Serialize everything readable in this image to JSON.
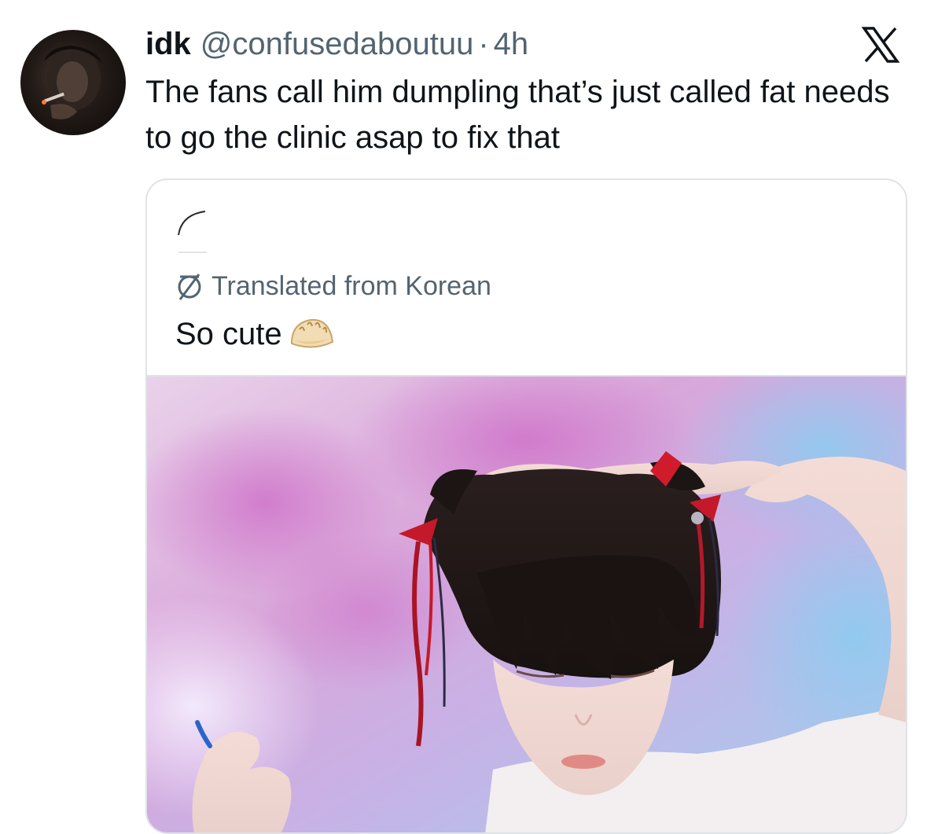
{
  "tweet": {
    "display_name": "idk",
    "handle": "@confusedaboutuu",
    "separator": "·",
    "time": "4h",
    "text": "The fans call him dumpling that’s just called fat needs to go the clinic asap to fix that",
    "avatar_icon": "avatar-photo"
  },
  "platform": {
    "logo_icon": "x-logo-icon"
  },
  "quote": {
    "translated_label": "Translated from Korean",
    "translate_icon": "translate-globe-icon",
    "text": "So cute",
    "emoji": "dumpling-emoji",
    "media_icon": "photo-image"
  },
  "colors": {
    "text_primary": "#0f1419",
    "text_secondary": "#536471",
    "border": "#dfe3e6"
  }
}
